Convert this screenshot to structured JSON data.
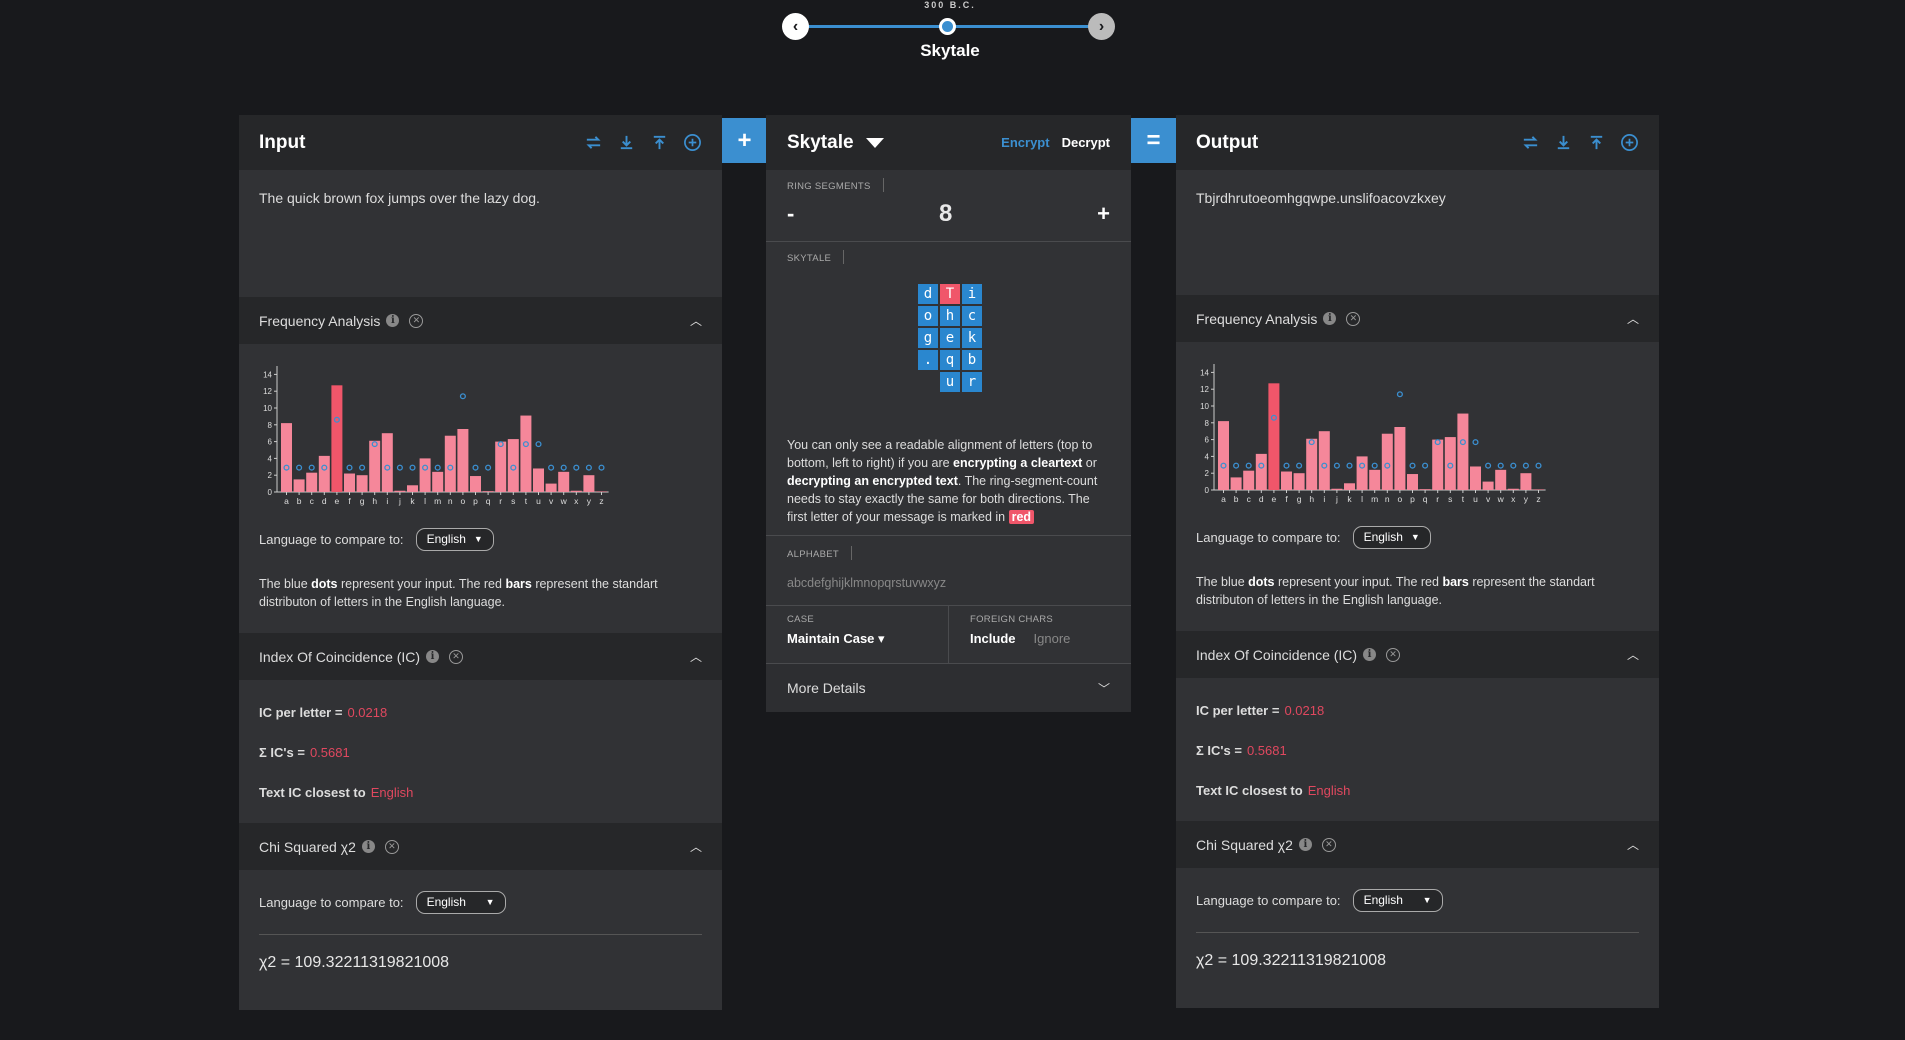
{
  "timeline": {
    "era": "300 B.C.",
    "name": "Skytale"
  },
  "input": {
    "title": "Input",
    "text": "The quick brown fox jumps over the lazy dog.",
    "freq": {
      "title": "Frequency Analysis",
      "lang_label": "Language to compare to:",
      "lang": "English",
      "desc_1": "The blue ",
      "desc_dots": "dots",
      "desc_2": " represent your input. The red ",
      "desc_bars": "bars",
      "desc_3": " represent the standart distributon of letters in the English language."
    },
    "ic": {
      "title": "Index Of Coincidence (IC)",
      "per_letter_label": "IC per letter =",
      "per_letter": "0.0218",
      "sum_label": "Σ IC's =",
      "sum": "0.5681",
      "closest_label": "Text IC closest to",
      "closest": "English"
    },
    "chi": {
      "title": "Chi Squared χ2",
      "lang_label": "Language to compare to:",
      "lang": "English",
      "value": "χ2 = 109.32211319821008"
    }
  },
  "output": {
    "title": "Output",
    "text": "Tbjrdhrutoeomhgqwpe.unslifoacovzkxey",
    "freq": {
      "title": "Frequency Analysis",
      "lang_label": "Language to compare to:",
      "lang": "English",
      "desc_1": "The blue ",
      "desc_dots": "dots",
      "desc_2": " represent your input. The red ",
      "desc_bars": "bars",
      "desc_3": " represent the standart distributon of letters in the English language."
    },
    "ic": {
      "title": "Index Of Coincidence (IC)",
      "per_letter_label": "IC per letter =",
      "per_letter": "0.0218",
      "sum_label": "Σ IC's =",
      "sum": "0.5681",
      "closest_label": "Text IC closest to",
      "closest": "English"
    },
    "chi": {
      "title": "Chi Squared χ2",
      "lang_label": "Language to compare to:",
      "lang": "English",
      "value": "χ2 = 109.32211319821008"
    }
  },
  "ops": {
    "plus": "+",
    "equals": "="
  },
  "cipher": {
    "title": "Skytale",
    "encrypt": "Encrypt",
    "decrypt": "Decrypt",
    "ring_label": "RING SEGMENTS",
    "minus": "-",
    "segments": "8",
    "plus": "+",
    "skytale_label": "SKYTALE",
    "grid": [
      "d",
      "T",
      "i",
      "o",
      "h",
      "c",
      "g",
      "e",
      "k",
      ".",
      "q",
      "b",
      "",
      "u",
      "r"
    ],
    "grid_red_index": 1,
    "desc_1": "You can only see a readable alignment of letters (top to bottom, left to right) if you are ",
    "desc_b1": "encrypting a cleartext",
    "desc_2": " or ",
    "desc_b2": "decrypting an encrypted text",
    "desc_3": ". The ring-segment-count needs to stay exactly the same for both directions. The first letter of your message is marked in ",
    "desc_red": "red",
    "alphabet_label": "ALPHABET",
    "alphabet": "abcdefghijklmnopqrstuvwxyz",
    "case_label": "CASE",
    "case_value": "Maintain Case ▾",
    "foreign_label": "FOREIGN CHARS",
    "foreign_include": "Include",
    "foreign_ignore": "Ignore",
    "more": "More Details"
  },
  "chart_data": {
    "type": "bar",
    "categories": [
      "a",
      "b",
      "c",
      "d",
      "e",
      "f",
      "g",
      "h",
      "i",
      "j",
      "k",
      "l",
      "m",
      "n",
      "o",
      "p",
      "q",
      "r",
      "s",
      "t",
      "u",
      "v",
      "w",
      "x",
      "y",
      "z"
    ],
    "y_ticks": [
      "0",
      "2",
      "4",
      "6",
      "8",
      "10",
      "12",
      "14"
    ],
    "ylim": [
      0,
      15
    ],
    "series": [
      {
        "values": [
          8.2,
          1.5,
          2.3,
          4.3,
          12.7,
          2.2,
          2.0,
          6.1,
          7.0,
          0.15,
          0.8,
          4.0,
          2.4,
          6.7,
          7.5,
          1.9,
          0.1,
          6.0,
          6.3,
          9.1,
          2.8,
          1.0,
          2.4,
          0.15,
          2.0,
          0.07
        ]
      },
      {
        "values": [
          2.9,
          2.9,
          2.9,
          2.9,
          8.6,
          2.9,
          2.9,
          5.7,
          2.9,
          2.9,
          2.9,
          2.9,
          2.9,
          2.9,
          11.4,
          2.9,
          2.9,
          5.7,
          2.9,
          5.7,
          5.7,
          2.9,
          2.9,
          2.9,
          2.9,
          2.9
        ]
      }
    ],
    "bar_color": "#f5879a",
    "highlight_color": "#f0566a",
    "dot_color": "#3b8fd0"
  }
}
